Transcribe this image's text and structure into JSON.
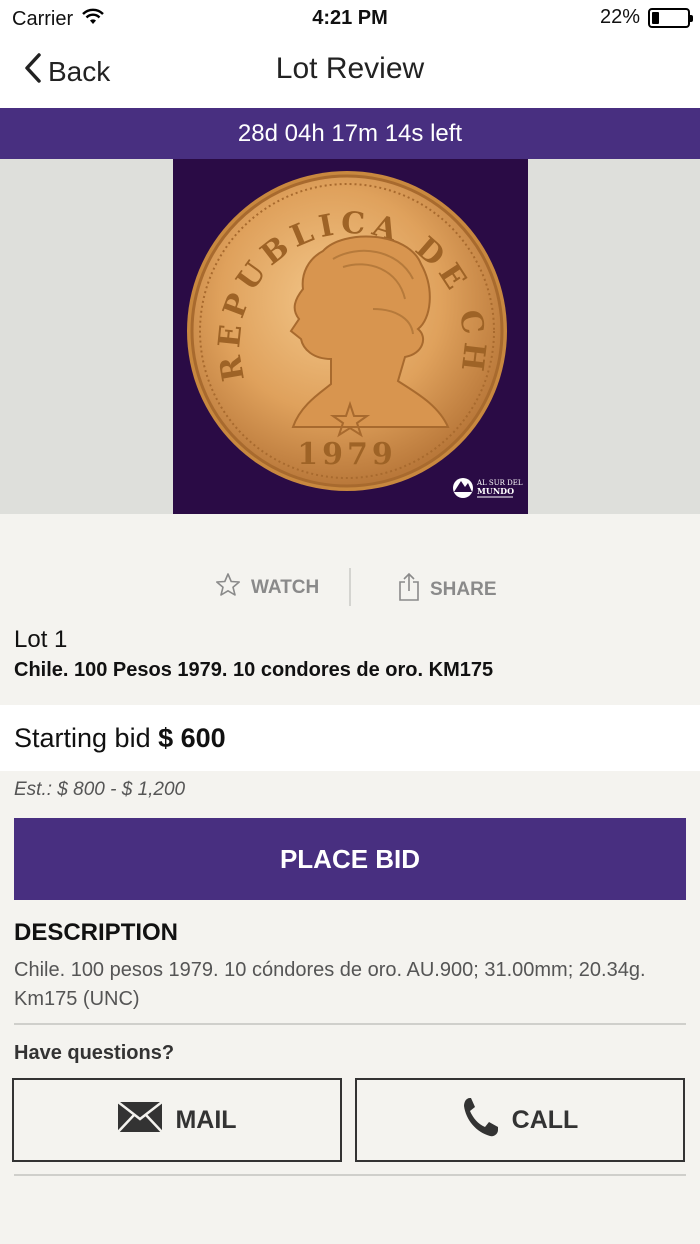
{
  "status_bar": {
    "carrier": "Carrier",
    "time": "4:21 PM",
    "battery": "22%",
    "battery_level": 0.22
  },
  "nav": {
    "back_label": "Back",
    "title": "Lot Review"
  },
  "timer": {
    "text": "28d 04h 17m 14s left"
  },
  "lot_image": {
    "coin_legend": "REPUBLICA DE CHILE",
    "coin_year": "1979",
    "watermark_line1": "AL SUR DEL",
    "watermark_line2": "MUNDO"
  },
  "actions": {
    "watch_label": "WATCH",
    "share_label": "SHARE"
  },
  "lot": {
    "number": "Lot 1",
    "title": "Chile. 100 Pesos 1979. 10 condores de oro. KM175"
  },
  "bid": {
    "label": "Starting bid ",
    "amount": "$ 600",
    "estimate": "Est.: $ 800 - $ 1,200",
    "place_bid_label": "PLACE BID"
  },
  "description": {
    "heading": "DESCRIPTION",
    "text": "Chile. 100 pesos 1979. 10 cóndores de oro. AU.900; 31.00mm; 20.34g. Km175 (UNC)"
  },
  "contact": {
    "questions": "Have questions?",
    "mail_label": "MAIL",
    "call_label": "CALL"
  },
  "colors": {
    "brand_purple": "#482f80",
    "background": "#f4f3ef"
  }
}
